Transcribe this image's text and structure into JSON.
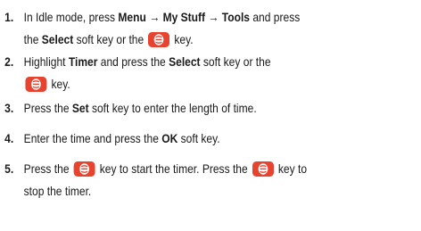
{
  "key_icon": {
    "name": "select-ok-key-icon",
    "color": "#e8432f"
  },
  "steps": [
    {
      "number": "1.",
      "l1": {
        "a": "In Idle mode, press ",
        "b1": "Menu",
        "c": " → ",
        "b2": "My Stuff",
        "d": " → ",
        "b3": "Tools",
        "e": " and press"
      },
      "l2": {
        "a": "the ",
        "b1": "Select",
        "c": " soft key or the ",
        "d": " key."
      }
    },
    {
      "number": "2.",
      "l1": {
        "a": "Highlight ",
        "b1": "Timer",
        "c": " and press the ",
        "b2": "Select",
        "d": " soft key or the"
      },
      "l2": {
        "a": " key."
      }
    },
    {
      "number": "3.",
      "l1": {
        "a": "Press the ",
        "b1": "Set",
        "c": " soft key to enter the length of time."
      }
    },
    {
      "number": "4.",
      "l1": {
        "a": "Enter the time and press the ",
        "b1": "OK",
        "c": " soft key."
      }
    },
    {
      "number": "5.",
      "l1": {
        "a": "Press the ",
        "b": " key to start the timer. Press the ",
        "c": " key to"
      },
      "l2": {
        "a": "stop the timer."
      }
    }
  ]
}
